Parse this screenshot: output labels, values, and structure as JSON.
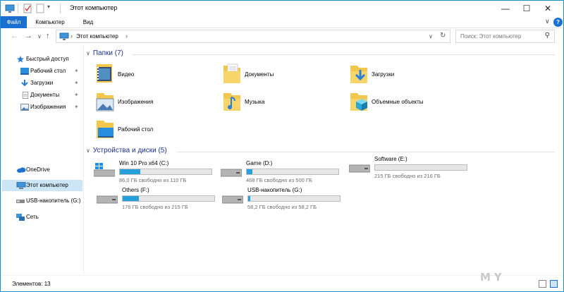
{
  "window": {
    "title": "Этот компьютер",
    "minimize_glyph": "—",
    "maximize_glyph": "☐",
    "close_glyph": "✕"
  },
  "ribbon": {
    "tabs": [
      "Файл",
      "Компьютер",
      "Вид"
    ],
    "collapse_glyph": "∨",
    "help_glyph": "?"
  },
  "nav": {
    "back_glyph": "←",
    "forward_glyph": "→",
    "recent_glyph": "∨",
    "up_glyph": "↑",
    "dropdown_glyph": "∨",
    "refresh_glyph": "↻",
    "address_path": "Этот компьютер",
    "address_sep_glyph": "›",
    "search_placeholder": "Поиск: Этот компьютер",
    "search_glyph": "⚲"
  },
  "sidebar": {
    "quick_access": "Быстрый доступ",
    "pinned": [
      {
        "label": "Рабочий стол",
        "icon": "desktop-icon"
      },
      {
        "label": "Загрузки",
        "icon": "downloads-icon"
      },
      {
        "label": "Документы",
        "icon": "documents-icon"
      },
      {
        "label": "Изображения",
        "icon": "pictures-icon"
      }
    ],
    "pin_glyph": "📌",
    "onedrive": "OneDrive",
    "this_pc": "Этот компьютер",
    "usb": "USB-накопитель (G:)",
    "network": "Сеть"
  },
  "content": {
    "folders_header": "Папки (7)",
    "folders": [
      {
        "label": "Видео",
        "icon": "videos-folder-icon"
      },
      {
        "label": "Документы",
        "icon": "documents-folder-icon"
      },
      {
        "label": "Загрузки",
        "icon": "downloads-folder-icon"
      },
      {
        "label": "Изображения",
        "icon": "pictures-folder-icon"
      },
      {
        "label": "Музыка",
        "icon": "music-folder-icon"
      },
      {
        "label": "Объемные объекты",
        "icon": "3d-objects-folder-icon"
      },
      {
        "label": "Рабочий стол",
        "icon": "desktop-folder-icon"
      }
    ],
    "devices_header": "Устройства и диски (5)",
    "drives": [
      {
        "name": "Win 10 Pro x64 (C:)",
        "free": "86,0 ГБ свободно из 110 ГБ",
        "used_fraction": 0.22,
        "icon": "windows-drive-icon"
      },
      {
        "name": "Game (D:)",
        "free": "468 ГБ свободно из 500 ГБ",
        "used_fraction": 0.06,
        "icon": "hdd-icon"
      },
      {
        "name": "Software (E:)",
        "free": "215 ГБ свободно из 216 ГБ",
        "used_fraction": 0.0,
        "icon": "hdd-icon"
      },
      {
        "name": "Others (F:)",
        "free": "176 ГБ свободно из 215 ГБ",
        "used_fraction": 0.18,
        "icon": "hdd-icon"
      },
      {
        "name": "USB-накопитель (G:)",
        "free": "58,2 ГБ свободно из 58,2 ГБ",
        "used_fraction": 0.02,
        "icon": "usb-drive-icon"
      }
    ]
  },
  "status": {
    "items_count": "Элементов: 13"
  },
  "watermark": "MY",
  "colors": {
    "accent": "#1a6fd1",
    "bar_fill": "#26a0da",
    "header_blue": "#1e3287",
    "folder_yellow": "#f3c74c"
  }
}
